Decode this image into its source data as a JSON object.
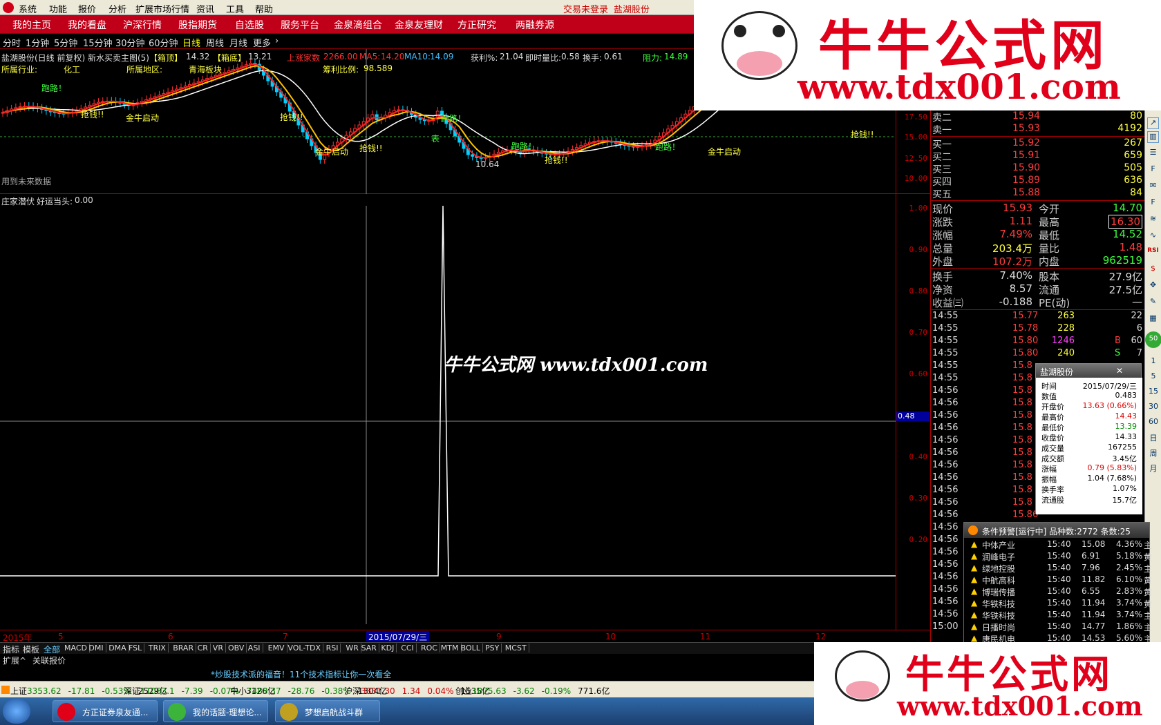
{
  "menu": {
    "items": [
      "系统",
      "功能",
      "报价",
      "分析",
      "扩展市场行情",
      "资讯",
      "工具",
      "帮助"
    ],
    "login_status": "交易未登录",
    "stock_name": "盐湖股份"
  },
  "nav": {
    "items": [
      "我的主页",
      "我的看盘",
      "沪深行情",
      "股指期货",
      "自选股",
      "服务平台",
      "金泉滴组合",
      "金泉友理财",
      "方正研究",
      "两融券源"
    ]
  },
  "periods": {
    "items": [
      "分时",
      "1分钟",
      "5分钟",
      "15分钟",
      "30分钟",
      "60分钟",
      "日线",
      "周线",
      "月线",
      "更多"
    ],
    "active": "日线"
  },
  "main_chart": {
    "title": "盐湖股份(日线 前复权) 新水买卖主图(5)",
    "box_top_label": "【箱顶】",
    "box_top": "14.32",
    "box_bottom_label": "【箱底】",
    "box_bottom": "13.21",
    "up_pressure_label": "上涨家数",
    "up_pressure": "2266.00",
    "ma5_label": "MA5:",
    "ma5": "14.20",
    "ma10_label": "MA10:",
    "ma10": "14.09",
    "profit_label": "获利%:",
    "profit": "21.04",
    "vol_ratio_label": "即时量比:",
    "vol_ratio": "0.58",
    "turnover_label": "换手:",
    "turnover": "0.61",
    "resist_label": "阻力:",
    "resist": "14.89",
    "industry_label": "所属行业:",
    "industry": "化工",
    "region_label": "所属地区:",
    "region": "青海板块",
    "profit_ratio_label": "筹利比例:",
    "profit_ratio": "98.589",
    "future_label": "用到未来数据",
    "markers": [
      "跑路！",
      "抢钱!!",
      "金牛启动",
      "表",
      "10.64"
    ],
    "axis": [
      "17.50",
      "15.00",
      "12.50",
      "10.00"
    ]
  },
  "indicator": {
    "title": "庄家潜伏",
    "subtitle": "好运当头:",
    "value": "0.00",
    "axis": [
      "1.00",
      "0.90",
      "0.80",
      "0.70",
      "0.60",
      "0.40",
      "0.30",
      "0.20"
    ],
    "cursor_value": "0.48"
  },
  "dates": {
    "labels": [
      "2015年",
      "5",
      "6",
      "7",
      "9",
      "10",
      "11",
      "12"
    ],
    "cursor": "2015/07/29/三",
    "period": "日线"
  },
  "tabs": {
    "left": [
      "指标",
      "模板",
      "全部"
    ],
    "indicators": [
      "MACD",
      "DMI",
      "DMA",
      "FSL",
      "TRIX",
      "BRAR",
      "CR",
      "VR",
      "OBV",
      "ASI",
      "EMV",
      "VOL-TDX",
      "RSI",
      "WR",
      "SAR",
      "KDJ",
      "CCI",
      "ROC",
      "MTM",
      "BOLL",
      "PSY",
      "MCST"
    ],
    "row2": [
      "扩展^",
      "关联报价"
    ]
  },
  "promo": "*炒股技术派的福音！11个技术指标让你一次看全",
  "status": {
    "items": [
      {
        "name": "上证",
        "value": "3353.62",
        "chg": "-17.81",
        "pct": "-0.53%",
        "amt": "2529亿"
      },
      {
        "name": "深证",
        "value": "11063.1",
        "chg": "-7.39",
        "pct": "-0.07%",
        "amt": "3126亿"
      },
      {
        "name": "中小",
        "value": "7488.37",
        "chg": "-28.76",
        "pct": "-0.38%",
        "amt": "1304亿"
      },
      {
        "name": "沪深",
        "value": "3831.30",
        "chg": "1.34",
        "pct": "0.04%",
        "amt": "1535亿"
      },
      {
        "name": "创业",
        "value": "1875.63",
        "chg": "-3.62",
        "pct": "-0.19%",
        "amt": "771.6亿"
      }
    ]
  },
  "taskbar": {
    "tasks": [
      "方正证券泉友通...",
      "我的话题-理想论...",
      "梦想启航战斗群"
    ]
  },
  "quote": {
    "sell": [
      {
        "label": "卖二",
        "price": "15.94",
        "vol": "80"
      },
      {
        "label": "卖一",
        "price": "15.93",
        "vol": "4192"
      }
    ],
    "buy": [
      {
        "label": "买一",
        "price": "15.92",
        "vol": "267"
      },
      {
        "label": "买二",
        "price": "15.91",
        "vol": "659"
      },
      {
        "label": "买三",
        "price": "15.90",
        "vol": "505"
      },
      {
        "label": "买四",
        "price": "15.89",
        "vol": "636"
      },
      {
        "label": "买五",
        "price": "15.88",
        "vol": "84"
      }
    ],
    "stats": [
      {
        "l1": "现价",
        "v1": "15.93",
        "l2": "今开",
        "v2": "14.70"
      },
      {
        "l1": "涨跌",
        "v1": "1.11",
        "l2": "最高",
        "v2": "16.30"
      },
      {
        "l1": "涨幅",
        "v1": "7.49%",
        "l2": "最低",
        "v2": "14.52"
      },
      {
        "l1": "总量",
        "v1": "203.4万",
        "l2": "量比",
        "v2": "1.48"
      },
      {
        "l1": "外盘",
        "v1": "107.2万",
        "l2": "内盘",
        "v2": "962519"
      }
    ],
    "fund": [
      {
        "l1": "换手",
        "v1": "7.40%",
        "l2": "股本",
        "v2": "27.9亿"
      },
      {
        "l1": "净资",
        "v1": "8.57",
        "l2": "流通",
        "v2": "27.5亿"
      },
      {
        "l1": "收益㈢",
        "v1": "-0.188",
        "l2": "PE(动)",
        "v2": "—"
      }
    ],
    "ticks": [
      {
        "t": "14:55",
        "p": "15.77",
        "v": "263",
        "f": "",
        "n": "22"
      },
      {
        "t": "14:55",
        "p": "15.78",
        "v": "228",
        "f": "",
        "n": "6"
      },
      {
        "t": "14:55",
        "p": "15.80",
        "v": "1246",
        "f": "B",
        "n": "60"
      },
      {
        "t": "14:55",
        "p": "15.80",
        "v": "240",
        "f": "S",
        "n": "7"
      },
      {
        "t": "14:55",
        "p": "15.8"
      },
      {
        "t": "14:55",
        "p": "15.8"
      },
      {
        "t": "14:56",
        "p": "15.8"
      },
      {
        "t": "14:56",
        "p": "15.8"
      },
      {
        "t": "14:56",
        "p": "15.8"
      },
      {
        "t": "14:56",
        "p": "15.8"
      },
      {
        "t": "14:56",
        "p": "15.8"
      },
      {
        "t": "14:56",
        "p": "15.8"
      },
      {
        "t": "14:56",
        "p": "15.8"
      },
      {
        "t": "14:56",
        "p": "15.8"
      },
      {
        "t": "14:56",
        "p": "15.8"
      },
      {
        "t": "14:56",
        "p": "15.8"
      },
      {
        "t": "14:56",
        "p": "15.86"
      },
      {
        "t": "14:56"
      },
      {
        "t": "14:56"
      },
      {
        "t": "14:56"
      },
      {
        "t": "14:56"
      },
      {
        "t": "14:56"
      },
      {
        "t": "14:56"
      },
      {
        "t": "14:56"
      },
      {
        "t": "14:56"
      },
      {
        "t": "15:00"
      }
    ]
  },
  "tools": [
    "1",
    "5",
    "15",
    "30",
    "60",
    "日",
    "周",
    "月"
  ],
  "popup_info": {
    "title": "盐湖股份",
    "close": "✕",
    "rows": [
      {
        "k": "时间",
        "v": "2015/07/29/三"
      },
      {
        "k": "数值",
        "v": "0.483"
      },
      {
        "k": "开盘价",
        "v": "13.63 (0.66%)"
      },
      {
        "k": "最高价",
        "v": "14.43"
      },
      {
        "k": "最低价",
        "v": "13.39"
      },
      {
        "k": "收盘价",
        "v": "14.33"
      },
      {
        "k": "成交量",
        "v": "167255"
      },
      {
        "k": "成交额",
        "v": "3.45亿"
      },
      {
        "k": "涨幅",
        "v": "0.79 (5.83%)"
      },
      {
        "k": "振幅",
        "v": "1.04 (7.68%)"
      },
      {
        "k": "换手率",
        "v": "1.07%"
      },
      {
        "k": "流通股",
        "v": "15.7亿"
      }
    ]
  },
  "popup_alert": {
    "title": "条件预警[运行中] 品种数:2772 条数:25",
    "rows": [
      {
        "n": "中体产业",
        "t": "15:40",
        "p": "15.08",
        "c": "4.36%",
        "x": "主"
      },
      {
        "n": "润峰电子",
        "t": "15:40",
        "p": "6.91",
        "c": "5.18%",
        "x": "黄"
      },
      {
        "n": "绿地控股",
        "t": "15:40",
        "p": "7.96",
        "c": "2.45%",
        "x": "主"
      },
      {
        "n": "中航高科",
        "t": "15:40",
        "p": "11.82",
        "c": "6.10%",
        "x": "黄"
      },
      {
        "n": "博瑞传播",
        "t": "15:40",
        "p": "6.55",
        "c": "2.83%",
        "x": "黄"
      },
      {
        "n": "华铁科技",
        "t": "15:40",
        "p": "11.94",
        "c": "3.74%",
        "x": "黄"
      },
      {
        "n": "华铁科技",
        "t": "15:40",
        "p": "11.94",
        "c": "3.74%",
        "x": "主"
      },
      {
        "n": "日播时尚",
        "t": "15:40",
        "p": "14.77",
        "c": "1.86%",
        "x": "主"
      },
      {
        "n": "唐民机电",
        "t": "15:40",
        "p": "14.53",
        "c": "5.60%",
        "x": "主"
      }
    ]
  },
  "watermark": {
    "brand": "牛牛公式网",
    "url": "www.tdx001.com",
    "center": "牛牛公式网 www.tdx001.com"
  },
  "chart_data": {
    "type": "line",
    "title": "庄家潜伏 好运当头",
    "ylim": [
      0.15,
      1.0
    ],
    "spike_at": "2015/07/29",
    "values": [
      0.0,
      0.0,
      1.0,
      0.0,
      0.0
    ]
  }
}
